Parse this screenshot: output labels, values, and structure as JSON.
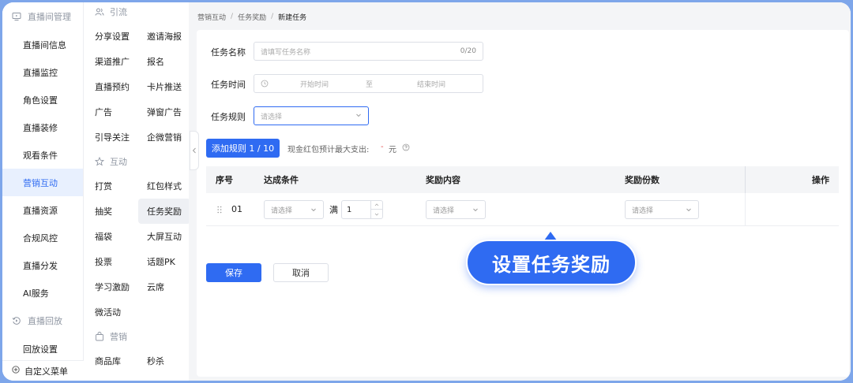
{
  "sidebar1": {
    "groups": [
      {
        "label": "直播间管理",
        "icon": "monitor-icon"
      },
      {
        "label": "直播回放",
        "icon": "replay-icon"
      }
    ],
    "items_a": [
      "直播间信息",
      "直播监控",
      "角色设置",
      "直播装修",
      "观看条件",
      "营销互动",
      "直播资源",
      "合规风控",
      "直播分发",
      "AI服务"
    ],
    "items_b": [
      "回放设置"
    ],
    "bottom": "自定义菜单",
    "active": "营销互动"
  },
  "sidebar2": {
    "sections": [
      {
        "title": "引流",
        "icon": "users-icon",
        "items": [
          "分享设置",
          "邀请海报",
          "渠道推广",
          "报名",
          "直播预约",
          "卡片推送",
          "广告",
          "弹窗广告",
          "引导关注",
          "企微营销"
        ]
      },
      {
        "title": "互动",
        "icon": "star-icon",
        "items": [
          "打赏",
          "红包样式",
          "抽奖",
          "任务奖励",
          "福袋",
          "大屏互动",
          "投票",
          "话题PK",
          "学习激励",
          "云席",
          "微活动"
        ]
      },
      {
        "title": "营销",
        "icon": "bag-icon",
        "items": [
          "商品库",
          "秒杀"
        ]
      }
    ],
    "active": "任务奖励"
  },
  "breadcrumb": [
    "营销互动",
    "任务奖励",
    "新建任务"
  ],
  "form": {
    "name_label": "任务名称",
    "name_placeholder": "请填写任务名称",
    "name_counter": "0/20",
    "time_label": "任务时间",
    "start_placeholder": "开始时间",
    "range_sep": "至",
    "end_placeholder": "结束时间",
    "rule_label": "任务规则",
    "rule_placeholder": "请选择"
  },
  "add_rule": {
    "button": "添加规则 1 / 10",
    "budget_label": "现金红包预计最大支出:",
    "budget_value": "-",
    "budget_unit": "元"
  },
  "table": {
    "headers": [
      "序号",
      "达成条件",
      "奖励内容",
      "奖励份数",
      "操作"
    ],
    "rows": [
      {
        "index": "01",
        "condition_placeholder": "请选择",
        "full_label": "满",
        "quantity": "1",
        "reward_placeholder": "请选择",
        "count_placeholder": "请选择"
      }
    ]
  },
  "actions": {
    "save": "保存",
    "cancel": "取消"
  },
  "callout": "设置任务奖励",
  "colors": {
    "primary": "#2f6bf2",
    "background": "#7ea6ea"
  }
}
